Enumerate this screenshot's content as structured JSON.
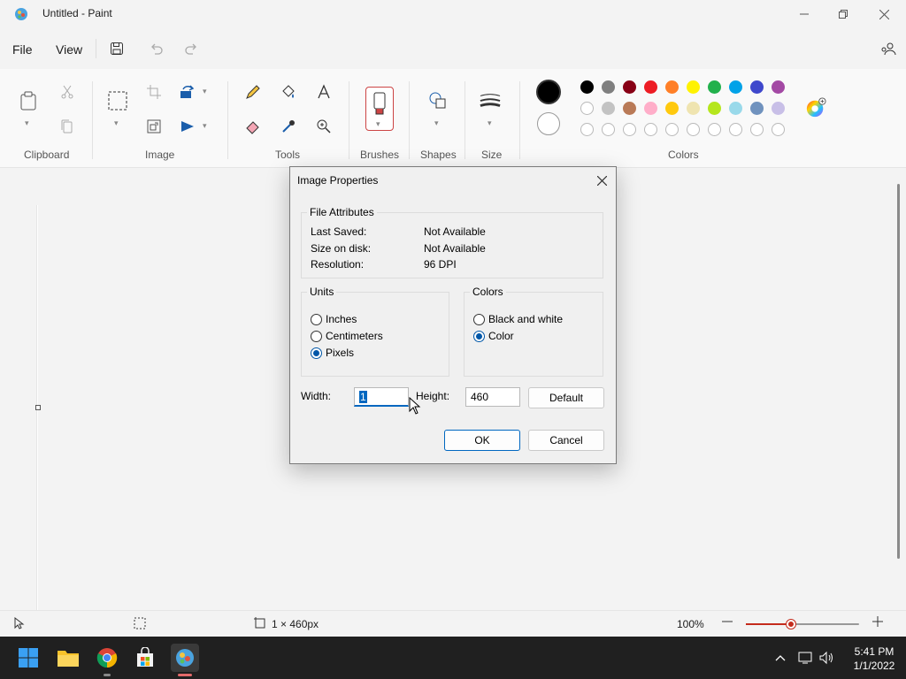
{
  "window": {
    "title": "Untitled - Paint"
  },
  "menubar": {
    "file": "File",
    "view": "View"
  },
  "ribbon": {
    "groups": {
      "clipboard": "Clipboard",
      "image": "Image",
      "tools": "Tools",
      "brushes": "Brushes",
      "shapes": "Shapes",
      "size": "Size",
      "colors": "Colors"
    },
    "current_colors": {
      "primary": "#000000",
      "secondary": "#ffffff"
    },
    "palette_row1": [
      "#000000",
      "#7f7f7f",
      "#880015",
      "#ed1c24",
      "#ff7f27",
      "#fff200",
      "#22b14c",
      "#00a2e8",
      "#3f48cc",
      "#a349a4"
    ],
    "palette_row2": [
      "#ffffff",
      "#c3c3c3",
      "#b97a57",
      "#ffaec9",
      "#ffc90e",
      "#efe4b0",
      "#b5e61d",
      "#99d9ea",
      "#7092be",
      "#c8bfe7"
    ],
    "palette_row3_empty_count_note": ""
  },
  "dialog": {
    "title": "Image Properties",
    "file_attributes": {
      "legend": "File Attributes",
      "rows": [
        {
          "label": "Last Saved:",
          "value": "Not Available"
        },
        {
          "label": "Size on disk:",
          "value": "Not Available"
        },
        {
          "label": "Resolution:",
          "value": "96 DPI"
        }
      ]
    },
    "units": {
      "legend": "Units",
      "options": [
        {
          "label": "Inches",
          "selected": false
        },
        {
          "label": "Centimeters",
          "selected": false
        },
        {
          "label": "Pixels",
          "selected": true
        }
      ]
    },
    "colors": {
      "legend": "Colors",
      "options": [
        {
          "label": "Black and white",
          "selected": false
        },
        {
          "label": "Color",
          "selected": true
        }
      ]
    },
    "width_label": "Width:",
    "width_value": "1",
    "height_label": "Height:",
    "height_value": "460",
    "default_button": "Default",
    "ok_button": "OK",
    "cancel_button": "Cancel"
  },
  "statusbar": {
    "canvas_size": "1 × 460px",
    "zoom": "100%",
    "zoom_level_fraction": 0.4
  },
  "taskbar": {
    "time": "5:41 PM",
    "date": "1/1/2022"
  },
  "accent": "#c42b1c"
}
